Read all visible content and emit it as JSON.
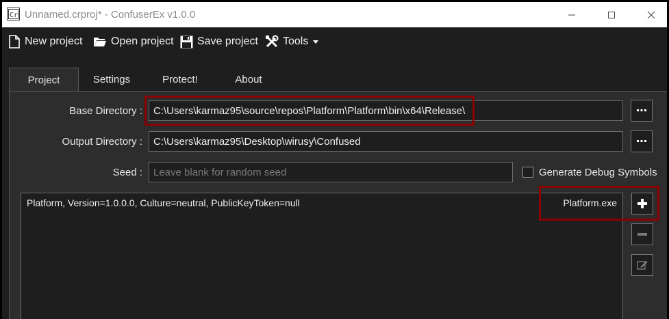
{
  "window": {
    "title": "Unnamed.crproj* - ConfuserEx v1.0.0"
  },
  "toolbar": {
    "new_label": "New project",
    "open_label": "Open project",
    "save_label": "Save project",
    "tools_label": "Tools"
  },
  "tabs": [
    {
      "label": "Project",
      "selected": true
    },
    {
      "label": "Settings",
      "selected": false
    },
    {
      "label": "Protect!",
      "selected": false
    },
    {
      "label": "About",
      "selected": false
    }
  ],
  "project": {
    "base_dir_label": "Base Directory :",
    "base_dir_value": "C:\\Users\\karmaz95\\source\\repos\\Platform\\Platform\\bin\\x64\\Release\\",
    "output_dir_label": "Output Directory :",
    "output_dir_value": "C:\\Users\\karmaz95\\Desktop\\wirusy\\Confused",
    "seed_label": "Seed :",
    "seed_placeholder": "Leave blank for random seed",
    "debug_symbols_label": "Generate Debug Symbols",
    "debug_symbols_checked": false,
    "modules": [
      {
        "assembly": "Platform, Version=1.0.0.0, Culture=neutral, PublicKeyToken=null",
        "file": "Platform.exe"
      }
    ]
  },
  "colors": {
    "highlight": "#8b0000",
    "background": "#1e1e1e",
    "panel": "#2d2d2d"
  }
}
